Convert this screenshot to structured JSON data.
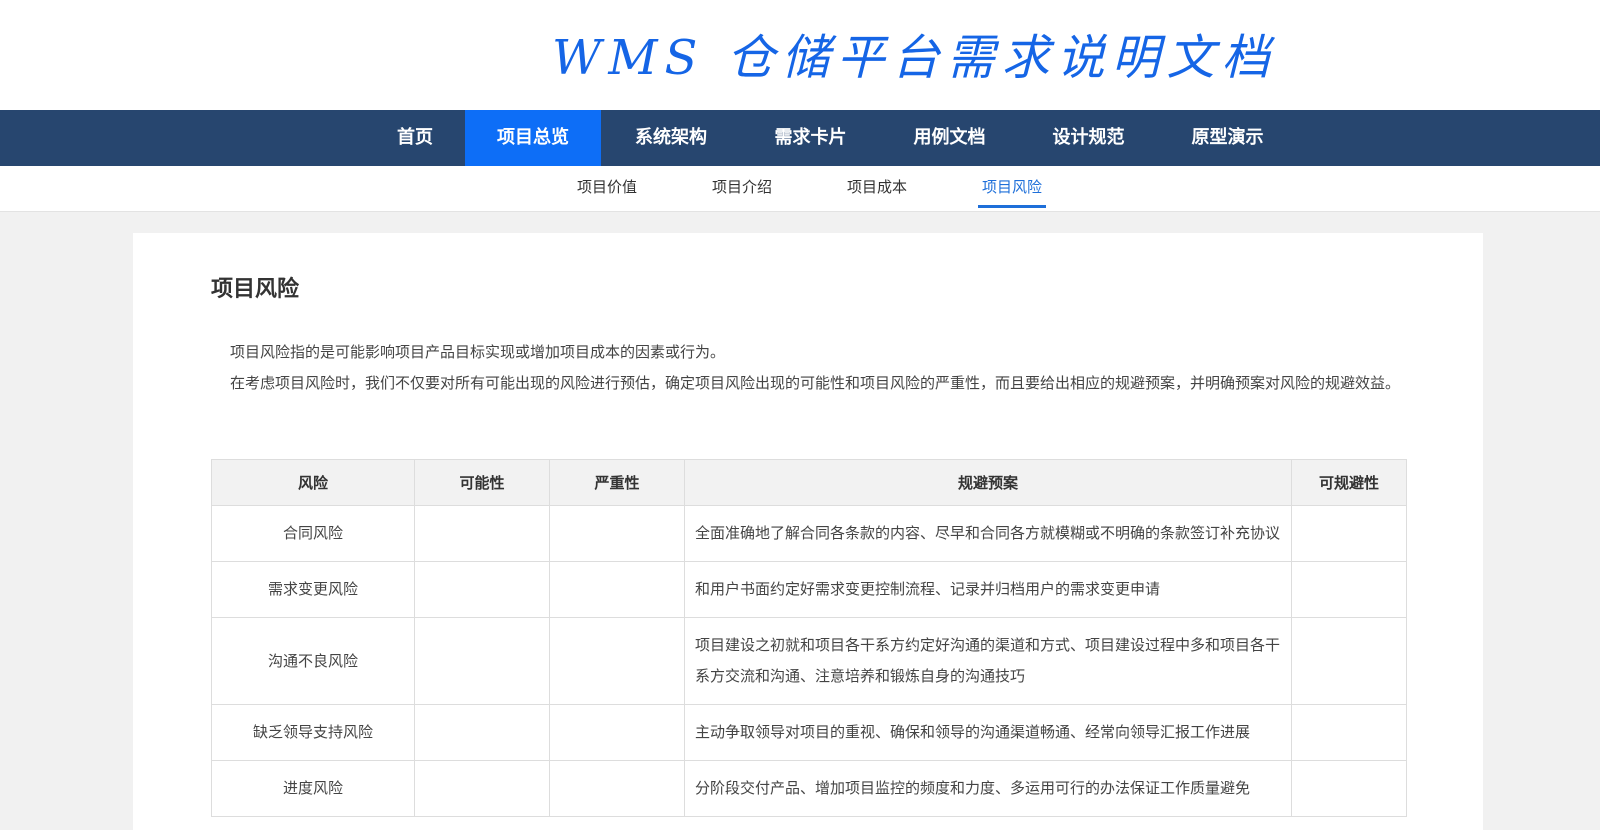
{
  "header": {
    "title": "WMS 仓储平台需求说明文档"
  },
  "nav": {
    "items": [
      {
        "label": "首页"
      },
      {
        "label": "项目总览"
      },
      {
        "label": "系统架构"
      },
      {
        "label": "需求卡片"
      },
      {
        "label": "用例文档"
      },
      {
        "label": "设计规范"
      },
      {
        "label": "原型演示"
      }
    ],
    "active": "项目总览"
  },
  "subnav": {
    "items": [
      {
        "label": "项目价值"
      },
      {
        "label": "项目介绍"
      },
      {
        "label": "项目成本"
      },
      {
        "label": "项目风险"
      }
    ],
    "active": "项目风险"
  },
  "main": {
    "title": "项目风险",
    "paragraphs": [
      "项目风险指的是可能影响项目产品目标实现或增加项目成本的因素或行为。",
      "在考虑项目风险时，我们不仅要对所有可能出现的风险进行预估，确定项目风险出现的可能性和项目风险的严重性，而且要给出相应的规避预案，并明确预案对风险的规避效益。"
    ],
    "table": {
      "headers": [
        "风险",
        "可能性",
        "严重性",
        "规避预案",
        "可规避性"
      ],
      "rows": [
        {
          "risk": "合同风险",
          "likelihood": "",
          "severity": "",
          "plan": "全面准确地了解合同各条款的内容、尽早和合同各方就模糊或不明确的条款签订补充协议",
          "avoidability": ""
        },
        {
          "risk": "需求变更风险",
          "likelihood": "",
          "severity": "",
          "plan": "和用户书面约定好需求变更控制流程、记录并归档用户的需求变更申请",
          "avoidability": ""
        },
        {
          "risk": "沟通不良风险",
          "likelihood": "",
          "severity": "",
          "plan": "项目建设之初就和项目各干系方约定好沟通的渠道和方式、项目建设过程中多和项目各干系方交流和沟通、注意培养和锻炼自身的沟通技巧",
          "avoidability": ""
        },
        {
          "risk": "缺乏领导支持风险",
          "likelihood": "",
          "severity": "",
          "plan": "主动争取领导对项目的重视、确保和领导的沟通渠道畅通、经常向领导汇报工作进展",
          "avoidability": ""
        },
        {
          "risk": "进度风险",
          "likelihood": "",
          "severity": "",
          "plan": "分阶段交付产品、增加项目监控的频度和力度、多运用可行的办法保证工作质量避免",
          "avoidability": ""
        }
      ]
    }
  },
  "colors": {
    "nav_bg": "#27466f",
    "nav_active": "#0d6ef7",
    "title_blue": "#1565e6",
    "subnav_active": "#1e6fd9"
  }
}
